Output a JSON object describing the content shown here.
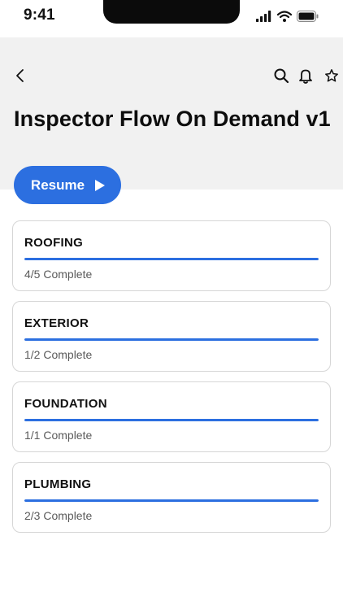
{
  "status_bar": {
    "time": "9:41",
    "icons": [
      "cellular-signal-icon",
      "wifi-icon",
      "battery-icon"
    ]
  },
  "header": {
    "title": "Inspector Flow On Demand v1",
    "background_color": "#f1f1f1",
    "icons": [
      "back-chevron-icon",
      "search-icon",
      "bell-icon",
      "star-icon"
    ]
  },
  "resume_button": {
    "label": "Resume",
    "color": "#2c6fe0",
    "icon": "play-icon"
  },
  "sections": [
    {
      "title": "ROOFING",
      "status": "4/5 Complete",
      "progress": 1.0
    },
    {
      "title": "EXTERIOR",
      "status": "1/2 Complete",
      "progress": 1.0
    },
    {
      "title": "FOUNDATION",
      "status": "1/1 Complete",
      "progress": 1.0
    },
    {
      "title": "PLUMBING",
      "status": "2/3 Complete",
      "progress": 1.0
    }
  ],
  "colors": {
    "accent": "#2c6fe0",
    "card_border": "#d6d6d6",
    "muted_text": "#5a5a5a"
  }
}
